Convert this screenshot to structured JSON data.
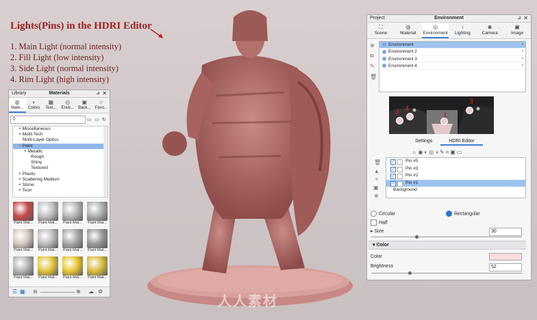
{
  "annotation": {
    "title": "Lights(Pins) in the HDRI Editor",
    "items": [
      "1. Main Light (normal intensity)",
      "2. Fill Light (low intensity)",
      "3. Side Light (normal intensity)",
      "4. Rim Light (high intensity)"
    ],
    "pin_numbers": [
      "2",
      "4",
      "1",
      "3"
    ]
  },
  "library": {
    "left_title": "Library",
    "title": "Materials",
    "tabs": [
      "Mate...",
      "Colors",
      "Text...",
      "Envir...",
      "Back...",
      "Favo..."
    ],
    "search_icon": "search-icon",
    "tree": [
      "Miscellaneous",
      "Mold-Tech",
      "Multi-Layer Optics",
      "Paint",
      "Metallic",
      "Rough",
      "Shiny",
      "Textured",
      "Plastic",
      "Scattering Medium",
      "Stone",
      "Toon"
    ],
    "selected": "Paint",
    "thumb_label": "Paint Mat...",
    "thumbs": [
      {
        "color": "#c44b4b"
      },
      {
        "color": "#c2c2c2"
      },
      {
        "color": "#b8b8b8"
      },
      {
        "color": "#b0b0b0"
      },
      {
        "color": "#d8c8c0"
      },
      {
        "color": "#bdbdbd"
      },
      {
        "color": "#a9a9a9"
      },
      {
        "color": "#9a9a9a"
      },
      {
        "color": "#b5b5b5"
      },
      {
        "color": "#e2c540"
      },
      {
        "color": "#e8c736"
      },
      {
        "color": "#d9bd3d"
      }
    ]
  },
  "environment_panel": {
    "project_label": "Project",
    "title": "Environment",
    "tabs": [
      "Scene",
      "Material",
      "Environment",
      "Lighting",
      "Camera",
      "Image"
    ],
    "active_tab": "Environment",
    "environments": [
      "Environment",
      "Environment 2",
      "Environment 3",
      "Environment 4"
    ],
    "subtabs": [
      "Settings",
      "HDRI Editor"
    ],
    "active_subtab": "HDRI Editor",
    "pins": [
      "Pin #5",
      "Pin #3",
      "Pin #2",
      "Pin #1"
    ],
    "background_label": "Background",
    "shape": {
      "circular": "Circular",
      "rectangular": "Rectangular",
      "selected": "Rectangular"
    },
    "half_label": "Half",
    "size_label": "Size",
    "size_value": "30",
    "color_section": "Color",
    "color_label": "Color",
    "color_swatch": "#f6dede",
    "brightness_label": "Brightness",
    "brightness_value": "52"
  },
  "watermark": "人人素材",
  "accent": "#c02020"
}
